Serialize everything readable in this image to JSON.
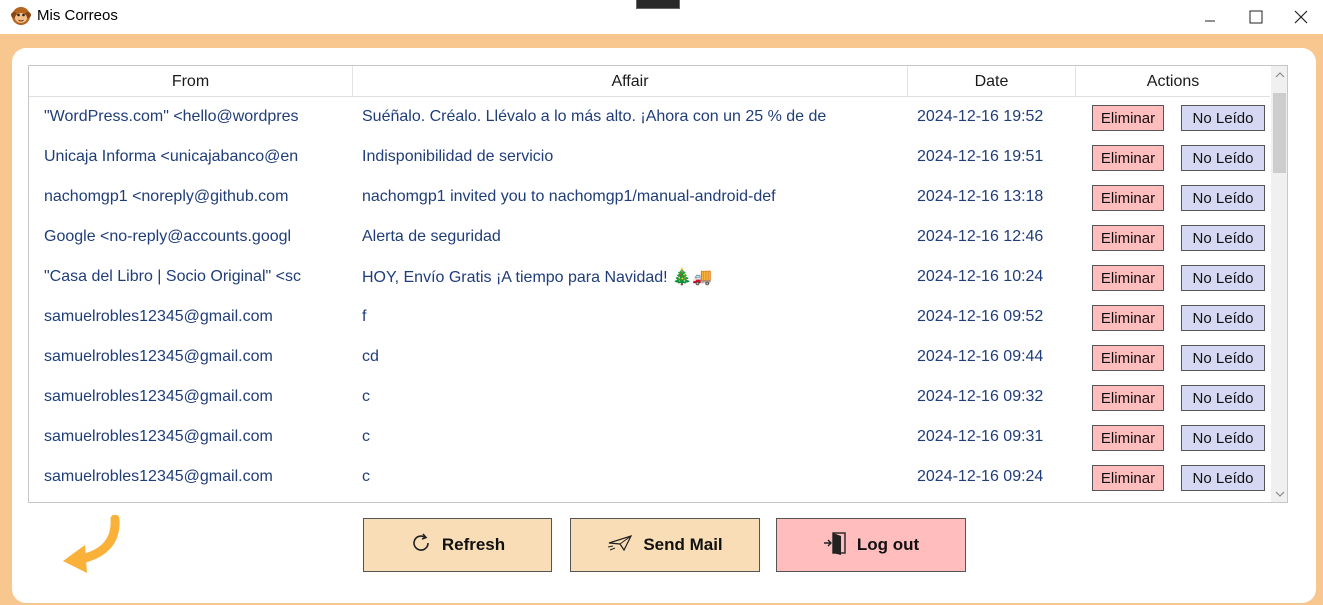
{
  "window": {
    "title": "Mis Correos"
  },
  "table": {
    "headers": {
      "from": "From",
      "affair": "Affair",
      "date": "Date",
      "actions": "Actions"
    },
    "rows": [
      {
        "from": "\"WordPress.com\" <hello@wordpres",
        "affair": "Suéñalo. Créalo. Llévalo a lo más alto. ¡Ahora con un 25 % de de",
        "date": "2024-12-16 19:52",
        "delete": "Eliminar",
        "unread": "No Leído"
      },
      {
        "from": "Unicaja Informa <unicajabanco@en",
        "affair": "Indisponibilidad de servicio",
        "date": "2024-12-16 19:51",
        "delete": "Eliminar",
        "unread": "No Leído"
      },
      {
        "from": "nachomgp1 <noreply@github.com",
        "affair": "nachomgp1 invited you to nachomgp1/manual-android-def",
        "date": "2024-12-16 13:18",
        "delete": "Eliminar",
        "unread": "No Leído"
      },
      {
        "from": "Google <no-reply@accounts.googl",
        "affair": "Alerta de seguridad",
        "date": "2024-12-16 12:46",
        "delete": "Eliminar",
        "unread": "No Leído"
      },
      {
        "from": "\"Casa del Libro | Socio Original\" <sc",
        "affair": "HOY, Envío Gratis ¡A tiempo para Navidad! 🎄🚚",
        "date": "2024-12-16 10:24",
        "delete": "Eliminar",
        "unread": "No Leído"
      },
      {
        "from": "samuelrobles12345@gmail.com",
        "affair": "f",
        "date": "2024-12-16 09:52",
        "delete": "Eliminar",
        "unread": "No Leído"
      },
      {
        "from": "samuelrobles12345@gmail.com",
        "affair": "cd",
        "date": "2024-12-16 09:44",
        "delete": "Eliminar",
        "unread": "No Leído"
      },
      {
        "from": "samuelrobles12345@gmail.com",
        "affair": "c",
        "date": "2024-12-16 09:32",
        "delete": "Eliminar",
        "unread": "No Leído"
      },
      {
        "from": "samuelrobles12345@gmail.com",
        "affair": "c",
        "date": "2024-12-16 09:31",
        "delete": "Eliminar",
        "unread": "No Leído"
      },
      {
        "from": "samuelrobles12345@gmail.com",
        "affair": "c",
        "date": "2024-12-16 09:24",
        "delete": "Eliminar",
        "unread": "No Leído"
      }
    ]
  },
  "buttons": {
    "refresh": "Refresh",
    "send_mail": "Send Mail",
    "log_out": "Log out"
  },
  "icons": {
    "app": "monkey-avatar-icon",
    "back": "back-arrow-icon",
    "refresh": "refresh-icon",
    "send_mail": "paper-plane-icon",
    "log_out": "exit-door-icon"
  },
  "colors": {
    "frame": "#f7c78f",
    "delete_button": "#ffbdbd",
    "unread_button": "#d4d8f2",
    "action_button": "#f9ddb6",
    "logout_button": "#ffbdbd",
    "text_link": "#1f3d7a"
  }
}
